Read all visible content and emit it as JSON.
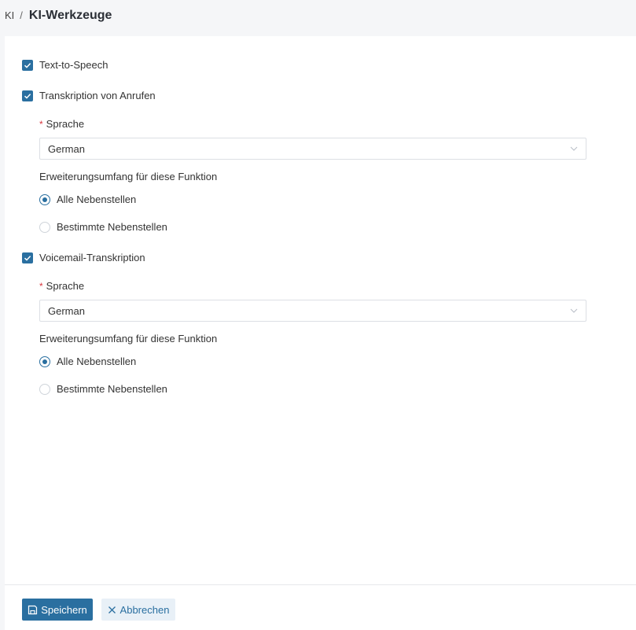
{
  "breadcrumb": {
    "parent": "KI",
    "separator": "/",
    "current": "KI-Werkzeuge"
  },
  "features": [
    {
      "label": "Text-to-Speech",
      "checked": true
    },
    {
      "label": "Transkription von Anrufen",
      "checked": true,
      "language_label": "Sprache",
      "language_value": "German",
      "scope_label": "Erweiterungsumfang für diese Funktion",
      "options": [
        {
          "label": "Alle Nebenstellen",
          "selected": true
        },
        {
          "label": "Bestimmte Nebenstellen",
          "selected": false
        }
      ]
    },
    {
      "label": "Voicemail-Transkription",
      "checked": true,
      "language_label": "Sprache",
      "language_value": "German",
      "scope_label": "Erweiterungsumfang für diese Funktion",
      "options": [
        {
          "label": "Alle Nebenstellen",
          "selected": true
        },
        {
          "label": "Bestimmte Nebenstellen",
          "selected": false
        }
      ]
    }
  ],
  "footer": {
    "save_label": "Speichern",
    "cancel_label": "Abbrechen"
  },
  "colors": {
    "accent": "#2a6fa0",
    "required": "#d9363e"
  },
  "icons": {
    "save": "floppy-disk-icon",
    "cancel": "close-icon",
    "checkbox": "checkmark-icon",
    "select": "chevron-down-icon"
  }
}
